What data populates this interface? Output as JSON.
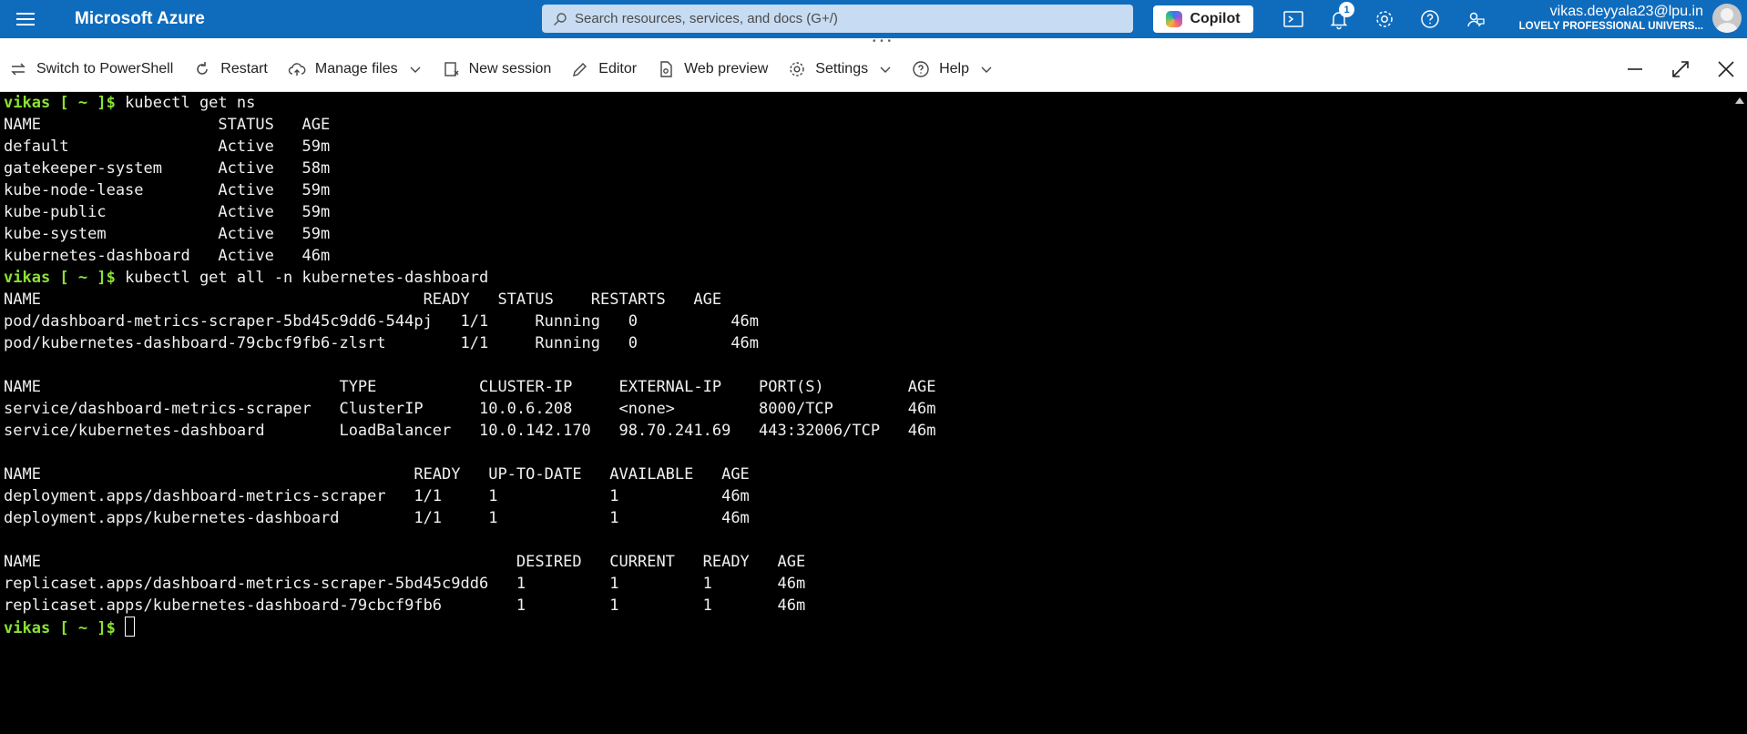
{
  "topbar": {
    "brand": "Microsoft Azure",
    "search_placeholder": "Search resources, services, and docs (G+/)",
    "copilot_label": "Copilot",
    "notification_count": "1",
    "user_name": "vikas.deyyala23@lpu.in",
    "user_org": "LOVELY PROFESSIONAL UNIVERS...",
    "colors": {
      "bar": "#0f6cbd",
      "search": "#c7dcf2"
    }
  },
  "toolbar": {
    "switch_label": "Switch to PowerShell",
    "restart_label": "Restart",
    "manage_files_label": "Manage files",
    "new_session_label": "New session",
    "editor_label": "Editor",
    "web_preview_label": "Web preview",
    "settings_label": "Settings",
    "help_label": "Help"
  },
  "terminal": {
    "prompt": "vikas [ ~ ]$",
    "lines": [
      {
        "prompt": true,
        "text": " kubectl get ns"
      },
      {
        "prompt": false,
        "text": "NAME                   STATUS   AGE"
      },
      {
        "prompt": false,
        "text": "default                Active   59m"
      },
      {
        "prompt": false,
        "text": "gatekeeper-system      Active   58m"
      },
      {
        "prompt": false,
        "text": "kube-node-lease        Active   59m"
      },
      {
        "prompt": false,
        "text": "kube-public            Active   59m"
      },
      {
        "prompt": false,
        "text": "kube-system            Active   59m"
      },
      {
        "prompt": false,
        "text": "kubernetes-dashboard   Active   46m"
      },
      {
        "prompt": true,
        "text": " kubectl get all -n kubernetes-dashboard"
      },
      {
        "prompt": false,
        "text": "NAME                                         READY   STATUS    RESTARTS   AGE"
      },
      {
        "prompt": false,
        "text": "pod/dashboard-metrics-scraper-5bd45c9dd6-544pj   1/1     Running   0          46m"
      },
      {
        "prompt": false,
        "text": "pod/kubernetes-dashboard-79cbcf9fb6-zlsrt        1/1     Running   0          46m"
      },
      {
        "prompt": false,
        "text": ""
      },
      {
        "prompt": false,
        "text": "NAME                                TYPE           CLUSTER-IP     EXTERNAL-IP    PORT(S)         AGE"
      },
      {
        "prompt": false,
        "text": "service/dashboard-metrics-scraper   ClusterIP      10.0.6.208     <none>         8000/TCP        46m"
      },
      {
        "prompt": false,
        "text": "service/kubernetes-dashboard        LoadBalancer   10.0.142.170   98.70.241.69   443:32006/TCP   46m"
      },
      {
        "prompt": false,
        "text": ""
      },
      {
        "prompt": false,
        "text": "NAME                                        READY   UP-TO-DATE   AVAILABLE   AGE"
      },
      {
        "prompt": false,
        "text": "deployment.apps/dashboard-metrics-scraper   1/1     1            1           46m"
      },
      {
        "prompt": false,
        "text": "deployment.apps/kubernetes-dashboard        1/1     1            1           46m"
      },
      {
        "prompt": false,
        "text": ""
      },
      {
        "prompt": false,
        "text": "NAME                                                   DESIRED   CURRENT   READY   AGE"
      },
      {
        "prompt": false,
        "text": "replicaset.apps/dashboard-metrics-scraper-5bd45c9dd6   1         1         1       46m"
      },
      {
        "prompt": false,
        "text": "replicaset.apps/kubernetes-dashboard-79cbcf9fb6        1         1         1       46m"
      }
    ],
    "colors": {
      "prompt": "#8ae234",
      "text": "#f0f0f0",
      "background": "#000000"
    }
  }
}
